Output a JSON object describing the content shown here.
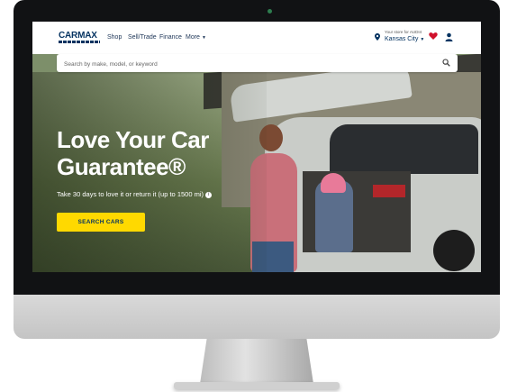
{
  "header": {
    "logo": "CARMAX",
    "nav": [
      {
        "label": "Shop"
      },
      {
        "label": "Sell/Trade"
      },
      {
        "label": "Finance"
      },
      {
        "label": "More",
        "icon": "chevron-down-icon"
      }
    ],
    "store": {
      "label": "Your store for AUDI4",
      "city": "Kansas City",
      "icon": "location-pin-icon"
    },
    "icons": [
      "heart-icon",
      "user-icon"
    ],
    "colors": {
      "brand": "#053361",
      "heart": "#d0112b"
    }
  },
  "search": {
    "placeholder": "Search by make, model, or keyword",
    "icon": "search-icon"
  },
  "hero": {
    "title": "Love Your Car Guarantee®",
    "subtitle": "Take 30 days to love it or return it (up to 1500 mi)",
    "cta_label": "SEARCH CARS",
    "cta_color": "#ffd900"
  }
}
